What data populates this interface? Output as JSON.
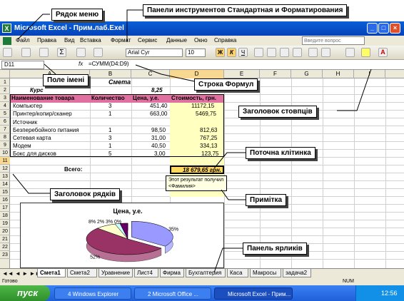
{
  "annotations": {
    "menu_row": "Рядок меню",
    "toolbars": "Панели инструментов Стандартная и Форматирования",
    "name_field": "Поле імені",
    "formula_bar": "Строка Формул",
    "column_header": "Заголовок стовпців",
    "current_cell": "Поточна клітинка",
    "row_header": "Заголовок рядків",
    "note": "Примітка",
    "sheet_tabs": "Панель ярликів"
  },
  "window": {
    "title": "Microsoft Excel - Прим.лаб.Exel"
  },
  "menu": [
    "Файл",
    "Правка",
    "Вид",
    "Вставка",
    "Формат",
    "Сервис",
    "Данные",
    "Окно",
    "Справка"
  ],
  "question_placeholder": "Введите вопрос",
  "toolbar": {
    "font": "Arial Cyr",
    "size": "10",
    "bold": "Ж",
    "italic": "К",
    "underline": "Ч"
  },
  "formula": {
    "name_box": "D11",
    "fx": "fx",
    "content": "=СУММ(D4:D9)"
  },
  "columns": [
    "A",
    "B",
    "C",
    "D",
    "E",
    "F",
    "G",
    "H",
    "I"
  ],
  "rows": [
    "1",
    "2",
    "3",
    "4",
    "5",
    "6",
    "7",
    "8",
    "9",
    "10",
    "11",
    "12",
    "13",
    "14",
    "15",
    "16",
    "17",
    "18",
    "19",
    "20",
    "21",
    "22",
    "23"
  ],
  "sheet": {
    "title": "Смета",
    "row2_a": "Курс",
    "row2_c": "8,25",
    "headers": [
      "Наименование товара",
      "Количество",
      "Цена, у.е.",
      "Стоимость, грн."
    ],
    "items": [
      {
        "name": "Компьютер",
        "qty": "3",
        "price": "451,40",
        "cost": "11172,15"
      },
      {
        "name": "Принтер/копир/сканер",
        "qty": "1",
        "price": "663,00",
        "cost": "5469,75"
      },
      {
        "name": "Источник",
        "qty": "",
        "price": "",
        "cost": ""
      },
      {
        "name": "Безперебойного питания",
        "qty": "1",
        "price": "98,50",
        "cost": "812,63"
      },
      {
        "name": "Сетевая карта",
        "qty": "3",
        "price": "31,00",
        "cost": "767,25"
      },
      {
        "name": "Модем",
        "qty": "1",
        "price": "40,50",
        "cost": "334,13"
      },
      {
        "name": "Бокс для дисков",
        "qty": "5",
        "price": "3,00",
        "cost": "123,75"
      }
    ],
    "total_label": "Всего:",
    "total_value": "18 679,65 грн.",
    "comment": "Этот результат получил <Фамилия>"
  },
  "chart_data": {
    "type": "pie",
    "title": "Цена, у.е.",
    "categories": [
      "Компьютер",
      "Принтер/копир/сканер",
      "Безперебойного питания",
      "Сетевая карта",
      "Модем",
      "Бокс для дисков"
    ],
    "values": [
      35,
      52,
      8,
      2,
      3,
      0
    ],
    "labels": [
      "35%",
      "52%",
      "8%",
      "2%",
      "3%",
      "0%"
    ],
    "colors": [
      "#9999ff",
      "#993366",
      "#ffffcc",
      "#ccffff",
      "#660066",
      "#ff8080"
    ]
  },
  "tabs": [
    "Смета1",
    "Смета2",
    "Уравнение",
    "Лист4",
    "Фирма",
    "Бухгалтерия",
    "Каса",
    "Макросы",
    "задача2"
  ],
  "status": {
    "left": "Готово",
    "right": "NUM"
  },
  "taskbar": {
    "start": "пуск",
    "tasks": [
      "4 Windows Explorer",
      "2 Microsoft Office ...",
      "Microsoft Excel - Прим..."
    ],
    "clock": "12:56"
  }
}
